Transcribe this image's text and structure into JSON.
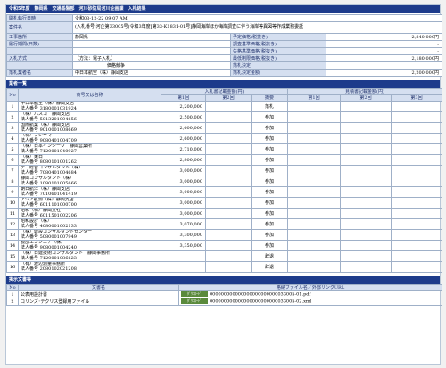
{
  "title": "令和5年度　静岡県　交通基盤部　河川砂防局河川企画課　入札結果",
  "info": {
    "open_date_label": "開札執行日時",
    "open_date_value": "令和03-12-22 09:07 AM",
    "case_name_label": "案件名",
    "case_name_value": "(入札番号:河企第33005号)令和3年度[第33-K1831-01号]静岡海岸ほか海岸調査に伴う海岸等異図等作成業務委託",
    "location_label": "工事箇所",
    "location_value": "静岡県",
    "period_label": "履行期間(日数)",
    "period_value": "",
    "method_label": "入札方式",
    "method_value": "（方法：電子入札）",
    "method_extra": "価格競争",
    "winner_label": "落札業者名",
    "winner_value": "中日本航空（株）静岡支店",
    "planned_price_label": "予定価格(税抜き)",
    "planned_price_value": "2,840,000円",
    "survey_base_label": "調査基準価格(税抜き)",
    "survey_base_value": "-",
    "loss_base_label": "失格基準価格(税抜き)",
    "loss_base_value": "-",
    "min_price_label": "最低制限価格(税抜き)",
    "min_price_value": "2,180,000円",
    "decision_label": "落札決定",
    "decision_value": "",
    "award_price_label": "落札決定金額",
    "award_price_value": "2,200,000円"
  },
  "bidders_section_title": "業者一覧",
  "bidders_headers": {
    "no": "No",
    "name": "商号又は名称",
    "bid_amount": "入札書記載金額(円)",
    "round1": "第1回",
    "round2": "第2回",
    "remarks": "摘要",
    "offer_amount": "見積書記載金額(円)",
    "est1": "第1回",
    "est2": "第2回",
    "est3": "第3回"
  },
  "bidders": [
    {
      "no": "1",
      "name": "中日本航空（株）静岡支店",
      "corp": "法人番号 3180001031924",
      "r1": "2,200,000",
      "r2": "",
      "remarks": "落札"
    },
    {
      "no": "2",
      "name": "（株）パスコ　静岡支店",
      "corp": "法人番号 5013201004656",
      "r1": "2,500,000",
      "r2": "",
      "remarks": "参加"
    },
    {
      "no": "3",
      "name": "国際航業（株）静岡支店",
      "corp": "法人番号 9010001008669",
      "r1": "2,600,000",
      "r2": "",
      "remarks": "参加"
    },
    {
      "no": "4",
      "name": "（株）フジヤマ",
      "corp": "法人番号 9080401004709",
      "r1": "2,600,000",
      "r2": "",
      "remarks": "参加"
    },
    {
      "no": "5",
      "name": "（株）日本インシーク　静岡営業所",
      "corp": "法人番号 7120001040927",
      "r1": "2,710,000",
      "r2": "",
      "remarks": "参加"
    },
    {
      "no": "6",
      "name": "（株）東日",
      "corp": "法人番号 8080101001262",
      "r1": "2,800,000",
      "r2": "",
      "remarks": "参加"
    },
    {
      "no": "7",
      "name": "テニ総合コンサルタント（株）",
      "corp": "法人番号 7080401004684",
      "r1": "3,000,000",
      "r2": "",
      "remarks": "参加"
    },
    {
      "no": "8",
      "name": "静岡コンサルタント（株）",
      "corp": "法人番号 1080101005666",
      "r1": "3,000,000",
      "r2": "",
      "remarks": "参加"
    },
    {
      "no": "9",
      "name": "朝日航洋（株）静岡支店",
      "corp": "法人番号 7010601041419",
      "r1": "3,000,000",
      "r2": "",
      "remarks": "参加"
    },
    {
      "no": "10",
      "name": "アジア航測（株）静岡支店",
      "corp": "法人番号 6011101000700",
      "r1": "3,000,000",
      "r2": "",
      "remarks": "参加"
    },
    {
      "no": "11",
      "name": "昭和（株）静岡支社",
      "corp": "法人番号 6011501002206",
      "r1": "3,000,000",
      "r2": "",
      "remarks": "参加"
    },
    {
      "no": "12",
      "name": "昭和設計（株）",
      "corp": "法人番号 4080001002133",
      "r1": "3,070,000",
      "r2": "",
      "remarks": "参加"
    },
    {
      "no": "13",
      "name": "（株）建設コンサルタントセンター",
      "corp": "法人番号 5080001007949",
      "r1": "3,300,000",
      "r2": "",
      "remarks": "参加"
    },
    {
      "no": "14",
      "name": "服部エンジニア（株）",
      "corp": "法人番号 9080001004240",
      "r1": "3,350,000",
      "r2": "",
      "remarks": "参加"
    },
    {
      "no": "15",
      "name": "（株）日建技術コンサルタント　静岡事務所",
      "corp": "法人番号 7120001086623",
      "r1": "",
      "r2": "",
      "remarks": "辞退"
    },
    {
      "no": "16",
      "name": "（有）渡辺測量事務所",
      "corp": "法人番号 2080102021208",
      "r1": "",
      "r2": "",
      "remarks": "辞退"
    }
  ],
  "docs_section_title": "掲示文書等",
  "docs_headers": {
    "no": "No",
    "name": "文書名",
    "file": "格納ファイル名／外部リンクURL"
  },
  "docs": [
    {
      "no": "1",
      "name": "公表用設計書",
      "button": "ﾀﾞｳﾝﾛｰﾄﾞ",
      "file": "000000000000000000000000033005-01.pdf"
    },
    {
      "no": "2",
      "name": "コリンズ･テクリス登録用ファイル",
      "button": "ﾀﾞｳﾝﾛｰﾄﾞ",
      "file": "000000000000000000000000033005-02.xml"
    }
  ]
}
